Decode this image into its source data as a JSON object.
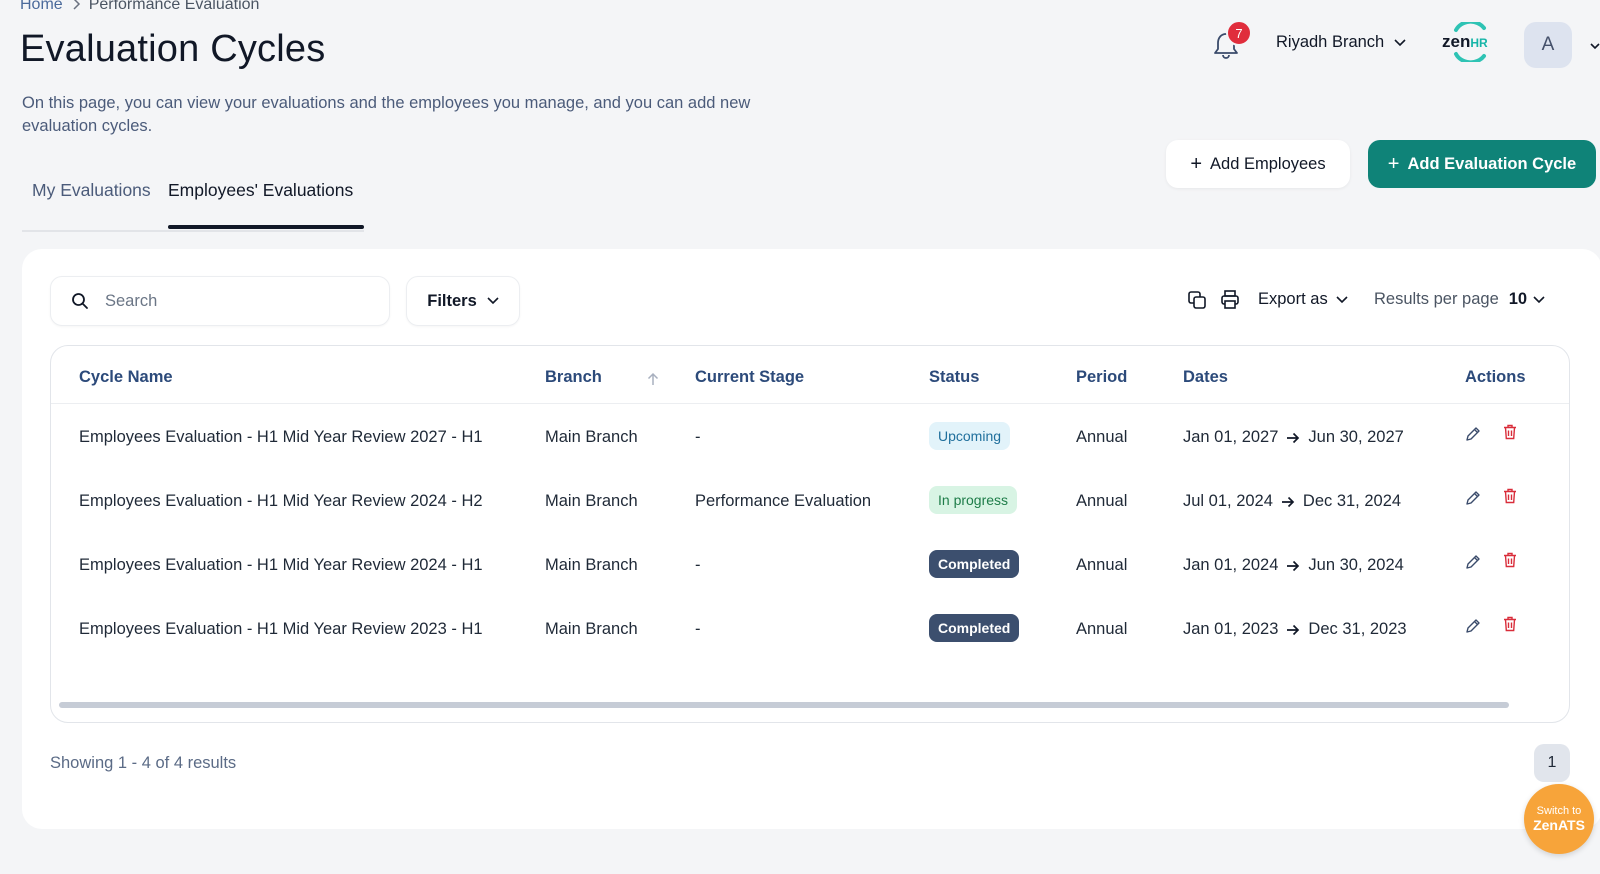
{
  "breadcrumb": {
    "home": "Home",
    "current": "Performance Evaluation"
  },
  "page": {
    "title": "Evaluation Cycles",
    "description": "On this page, you can view your evaluations and the employees you manage, and you can add new evaluation cycles."
  },
  "header": {
    "notification_count": "7",
    "branch": "Riyadh Branch",
    "logo_main": "zen",
    "logo_sub": "HR",
    "avatar_initial": "A"
  },
  "tabs": [
    {
      "label": "My Evaluations",
      "active": false
    },
    {
      "label": "Employees' Evaluations",
      "active": true
    }
  ],
  "actions": {
    "add_employees": "Add Employees",
    "add_cycle": "Add Evaluation Cycle",
    "plus": "+"
  },
  "toolbar": {
    "search_placeholder": "Search",
    "filters": "Filters",
    "export_as": "Export as",
    "results_per_page_label": "Results per page",
    "results_per_page_value": "10"
  },
  "table": {
    "columns": [
      "Cycle Name",
      "Branch",
      "Current Stage",
      "Status",
      "Period",
      "Dates",
      "Actions"
    ],
    "rows": [
      {
        "name": "Employees Evaluation - H1 Mid Year Review 2027 - H1",
        "branch": "Main Branch",
        "stage": "-",
        "status": "Upcoming",
        "period": "Annual",
        "start": "Jan 01, 2027",
        "end": "Jun 30, 2027"
      },
      {
        "name": "Employees Evaluation - H1 Mid Year Review 2024 - H2",
        "branch": "Main Branch",
        "stage": "Performance Evaluation",
        "status": "In progress",
        "period": "Annual",
        "start": "Jul 01, 2024",
        "end": "Dec 31, 2024"
      },
      {
        "name": "Employees Evaluation - H1 Mid Year Review 2024 - H1",
        "branch": "Main Branch",
        "stage": "-",
        "status": "Completed",
        "period": "Annual",
        "start": "Jan 01, 2024",
        "end": "Jun 30, 2024"
      },
      {
        "name": "Employees Evaluation - H1 Mid Year Review 2023 - H1",
        "branch": "Main Branch",
        "stage": "-",
        "status": "Completed",
        "period": "Annual",
        "start": "Jan 01, 2023",
        "end": "Dec 31, 2023"
      }
    ]
  },
  "footer": {
    "showing": "Showing 1 - 4 of 4 results",
    "page": "1",
    "switch_line1": "Switch to",
    "switch_line2": "ZenATS"
  },
  "colors": {
    "primary": "#0f8378",
    "badge_red": "#e02d3c",
    "delete_red": "#d92d3a",
    "zenats_orange": "#f7a43a",
    "completed_badge": "#3c4f6e"
  },
  "icons": [
    "chevron-right-icon",
    "bell-icon",
    "chevron-down-icon",
    "search-icon",
    "copy-icon",
    "print-icon",
    "sort-up-icon",
    "arrow-right-icon",
    "pencil-icon",
    "trash-icon"
  ]
}
